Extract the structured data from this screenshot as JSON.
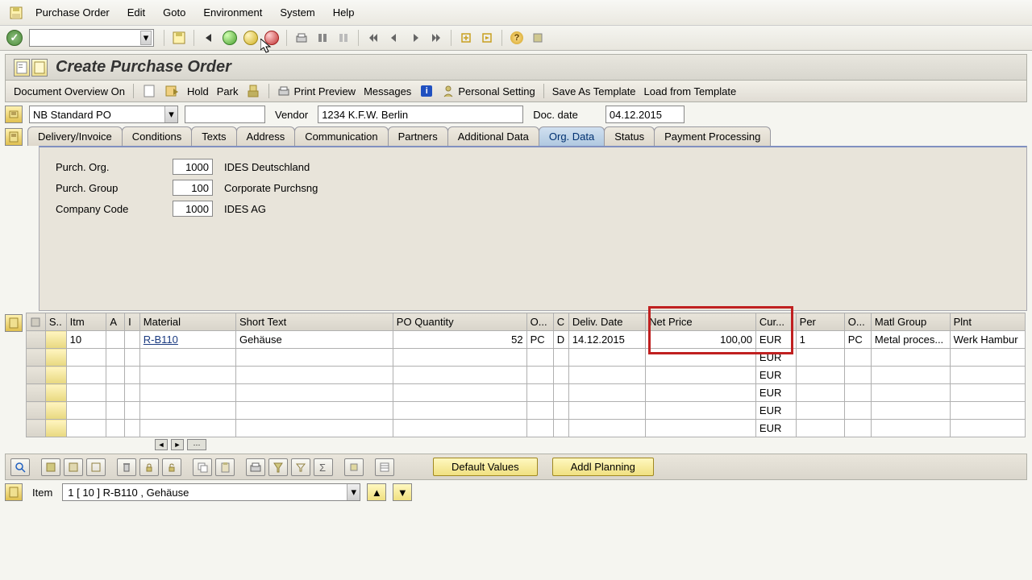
{
  "menu": {
    "po": "Purchase Order",
    "edit": "Edit",
    "goto": "Goto",
    "env": "Environment",
    "system": "System",
    "help": "Help"
  },
  "title": "Create Purchase Order",
  "apptb": {
    "doc_overview": "Document Overview On",
    "hold": "Hold",
    "park": "Park",
    "print_preview": "Print Preview",
    "messages": "Messages",
    "personal_setting": "Personal Setting",
    "save_as_template": "Save As Template",
    "load_from_template": "Load from Template"
  },
  "header": {
    "po_type": "NB Standard PO",
    "vendor_label": "Vendor",
    "vendor_value": "1234 K.F.W. Berlin",
    "docdate_label": "Doc. date",
    "docdate_value": "04.12.2015"
  },
  "tabs": {
    "delivery": "Delivery/Invoice",
    "conditions": "Conditions",
    "texts": "Texts",
    "address": "Address",
    "communication": "Communication",
    "partners": "Partners",
    "additional": "Additional Data",
    "orgdata": "Org. Data",
    "status": "Status",
    "payment": "Payment Processing"
  },
  "orgdata": {
    "purch_org_label": "Purch. Org.",
    "purch_org_val": "1000",
    "purch_org_desc": "IDES Deutschland",
    "purch_group_label": "Purch. Group",
    "purch_group_val": "100",
    "purch_group_desc": "Corporate Purchsng",
    "company_label": "Company Code",
    "company_val": "1000",
    "company_desc": "IDES AG"
  },
  "cols": {
    "s": "S..",
    "itm": "Itm",
    "a": "A",
    "i": "I",
    "material": "Material",
    "short_text": "Short Text",
    "po_qty": "PO Quantity",
    "o1": "O...",
    "c": "C",
    "deliv_date": "Deliv. Date",
    "net_price": "Net Price",
    "curr": "Cur...",
    "per": "Per",
    "o2": "O...",
    "matl_group": "Matl Group",
    "plnt": "Plnt"
  },
  "rows": [
    {
      "itm": "10",
      "material": "R-B110",
      "short_text": "Gehäuse",
      "qty": "52",
      "uom": "PC",
      "c": "D",
      "deliv": "14.12.2015",
      "price": "100,00",
      "curr": "EUR",
      "per": "1",
      "puom": "PC",
      "matl_group": "Metal proces...",
      "plnt": "Werk Hambur"
    },
    {
      "curr": "EUR"
    },
    {
      "curr": "EUR"
    },
    {
      "curr": "EUR"
    },
    {
      "curr": "EUR"
    },
    {
      "curr": "EUR"
    }
  ],
  "bottom": {
    "default_values": "Default Values",
    "addl_planning": "Addl Planning"
  },
  "item_detail": {
    "label": "Item",
    "value": "1 [ 10 ] R-B110 , Gehäuse"
  }
}
